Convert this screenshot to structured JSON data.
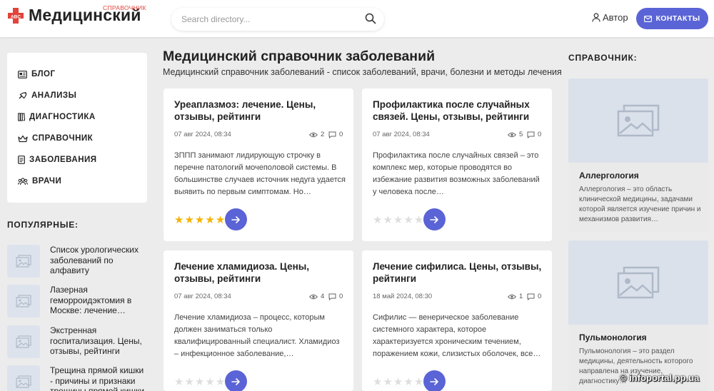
{
  "header": {
    "logo_text": "Медицинский",
    "logo_sub": "СПРАВОЧНИК",
    "search_placeholder": "Search directory...",
    "author_label": "Автор",
    "contact_label": "КОНТАКТЫ"
  },
  "menu": {
    "items": [
      {
        "label": "БЛОГ",
        "icon": "newspaper-icon"
      },
      {
        "label": "АНАЛИЗЫ",
        "icon": "satellite-icon"
      },
      {
        "label": "ДИАГНОСТИКА",
        "icon": "books-icon"
      },
      {
        "label": "СПРАВОЧНИК",
        "icon": "crown-icon"
      },
      {
        "label": "ЗАБОЛЕВАНИЯ",
        "icon": "document-icon"
      },
      {
        "label": "ВРАЧИ",
        "icon": "users-icon"
      }
    ]
  },
  "popular": {
    "title": "ПОПУЛЯРНЫЕ:",
    "items": [
      {
        "text": "Список урологических заболеваний по алфавиту"
      },
      {
        "text": "Лазерная геморроидэктомия в Москве: лечение…"
      },
      {
        "text": "Экстренная госпитализация. Цены, отзывы, рейтинги"
      },
      {
        "text": "Трещина прямой кишки - причины и признаки трещины прямой кишки"
      }
    ]
  },
  "main": {
    "title": "Медицинский справочник заболеваний",
    "subtitle": "Медицинский справочник заболеваний - список заболеваний, врачи, болезни и методы лечения",
    "articles": [
      {
        "title": "Уреаплазмоз: лечение. Цены, отзывы, рейтинги",
        "date": "07 авг 2024, 08:34",
        "views": "2",
        "comments": "0",
        "excerpt": "ЗППП занимают лидирующую строчку в перечне патологий мочеполовой системы. В большинстве случаев источник недуга удается выявить по первым симптомам. Но…",
        "rating": 5
      },
      {
        "title": "Профилактика после случайных связей. Цены, отзывы, рейтинги",
        "date": "07 авг 2024, 08:34",
        "views": "5",
        "comments": "0",
        "excerpt": "Профилактика после случайных связей – это комплекс мер, которые проводятся во избежание развития возможных заболеваний у человека после…",
        "rating": 0
      },
      {
        "title": "Лечение хламидиоза. Цены, отзывы, рейтинги",
        "date": "07 авг 2024, 08:34",
        "views": "4",
        "comments": "0",
        "excerpt": "Лечение хламидиоза – процесс, которым должен заниматься только квалифицированный специалист. Хламидиоз – инфекционное заболевание,…",
        "rating": 0
      },
      {
        "title": "Лечение сифилиса. Цены, отзывы, рейтинги",
        "date": "18 май 2024, 08:30",
        "views": "1",
        "comments": "0",
        "excerpt": "Сифилис — венерическое заболевание системного характера, которое характеризуется хроническим течением, поражением кожи, слизистых оболочек, все…",
        "rating": 0
      }
    ]
  },
  "sidebar": {
    "title": "СПРАВОЧНИК:",
    "cards": [
      {
        "title": "Аллергология",
        "text": "Аллергология – это область клинической медицины, задачами которой является изучение причин и механизмов развития…"
      },
      {
        "title": "Пульмонология",
        "text": "Пульмонология – это раздел медицины, деятельность которого направлена на изучение, диагностику…"
      }
    ]
  },
  "watermark": "© infoportal.pp.ua",
  "colors": {
    "accent": "#5a64d6",
    "star": "#f4b400",
    "logo_red": "#e2433b"
  }
}
